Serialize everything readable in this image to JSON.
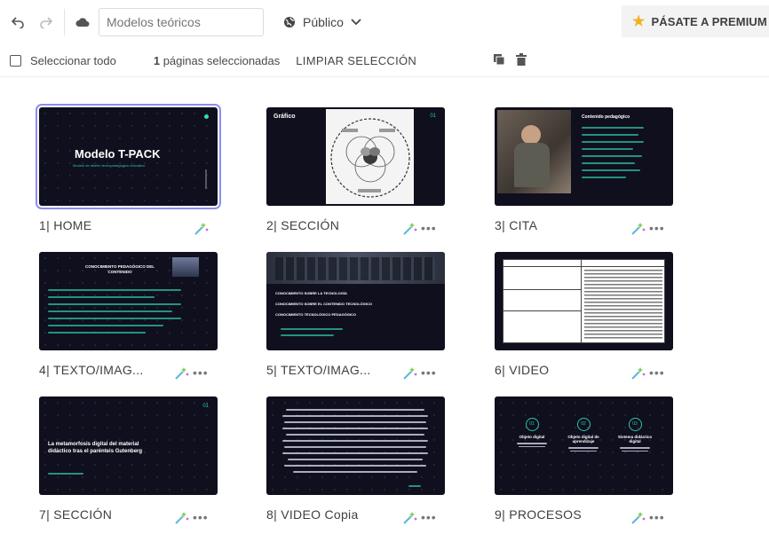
{
  "toolbar": {
    "title_placeholder": "Modelos teóricos",
    "visibility_label": "Público",
    "premium_label": "PÁSATE A PREMIUM"
  },
  "selection": {
    "select_all_label": "Seleccionar todo",
    "count_number": "1",
    "count_text": "páginas seleccionadas",
    "clear_label": "LIMPIAR SELECCIÓN"
  },
  "pages": [
    {
      "label": "1| HOME",
      "title": "Modelo T-PACK",
      "subtitle": "Modelo de diseño tecnopedagógico educativo"
    },
    {
      "label": "2| SECCIÓN",
      "heading": "Gráfico",
      "number": "01"
    },
    {
      "label": "3| CITA",
      "heading": "Contenido pedagógico"
    },
    {
      "label": "4| TEXTO/IMAG...",
      "heading": "CONOCIMIENTO PEDAGÓGICO DEL CONTENIDO"
    },
    {
      "label": "5| TEXTO/IMAG...",
      "items": [
        "CONOCIMIENTO SOBRE LA TECNOLOGÍA",
        "CONOCIMIENTO SOBRE EL CONTENIDO TECNOLÓGICO",
        "CONOCIMIENTO TECNOLÓGICO PEDAGÓGICO"
      ]
    },
    {
      "label": "6| VIDEO"
    },
    {
      "label": "7| SECCIÓN",
      "title": "La metamorfosis digital del material didáctico tras el parénteis Gutenberg",
      "number": "01"
    },
    {
      "label": "8| VIDEO Copia"
    },
    {
      "label": "9| PROCESOS",
      "steps": [
        {
          "num": "01",
          "title": "Objeto digital"
        },
        {
          "num": "02",
          "title": "Objeto digital de aprendizaje"
        },
        {
          "num": "03",
          "title": "Sistema didáctico digital"
        }
      ]
    }
  ]
}
